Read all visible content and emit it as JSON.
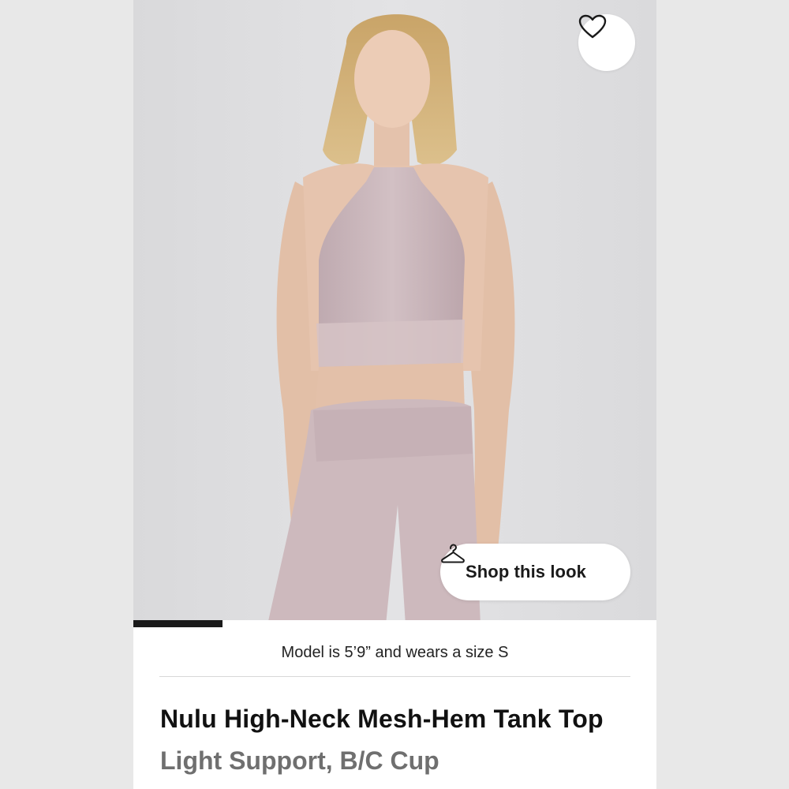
{
  "product": {
    "model_info": "Model is 5’9” and wears a size S",
    "title": "Nulu High-Neck Mesh-Hem Tank Top",
    "subtitle": "Light Support, B/C Cup"
  },
  "actions": {
    "shop_look_label": "Shop this look",
    "favorite_icon": "heart-outline-icon",
    "shop_look_icon": "hanger-icon"
  },
  "gallery": {
    "progress_fraction": 0.17
  },
  "colors": {
    "garment": "#cdb9bd",
    "background": "#dcdcde",
    "text_primary": "#111111",
    "text_secondary": "#6f6f6f"
  }
}
